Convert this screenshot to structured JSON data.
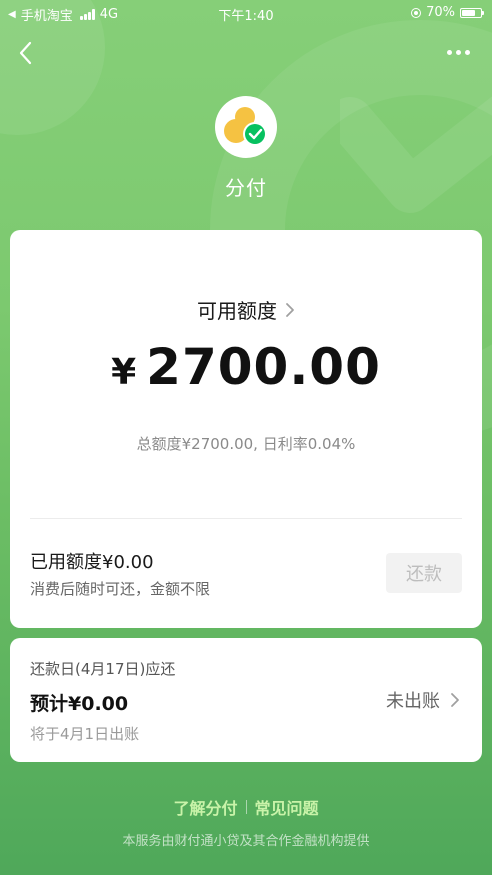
{
  "status_bar": {
    "back_app": "手机淘宝",
    "network": "4G",
    "time": "下午1:40",
    "battery": "70%",
    "battery_level": 0.7
  },
  "icons": {
    "back": "chevron-left-icon",
    "more": "more-dots-icon",
    "logo": "fenfu-logo-icon",
    "chevron": "chevron-right-icon"
  },
  "header": {
    "title": "分付"
  },
  "credit": {
    "available_label": "可用额度",
    "currency_symbol": "¥",
    "available_amount": "2700.00",
    "total_info": "总额度¥2700.00, 日利率0.04%",
    "used_label": "已用额度¥0.00",
    "used_sub": "消费后随时可还，金额不限",
    "repay_button": "还款"
  },
  "bill": {
    "due_label": "还款日(4月17日)应还",
    "estimate": "预计¥0.00",
    "note": "将于4月1日出账",
    "status": "未出账"
  },
  "footer": {
    "link_learn": "了解分付",
    "link_faq": "常见问题",
    "provider_note": "本服务由财付通小贷及其合作金融机构提供"
  },
  "colors": {
    "bg_top": "#86cf78",
    "bg_bottom": "#4fa85a",
    "accent_green": "#07c160",
    "coin_yellow": "#f5c242",
    "link_green": "#c9f3a9"
  }
}
